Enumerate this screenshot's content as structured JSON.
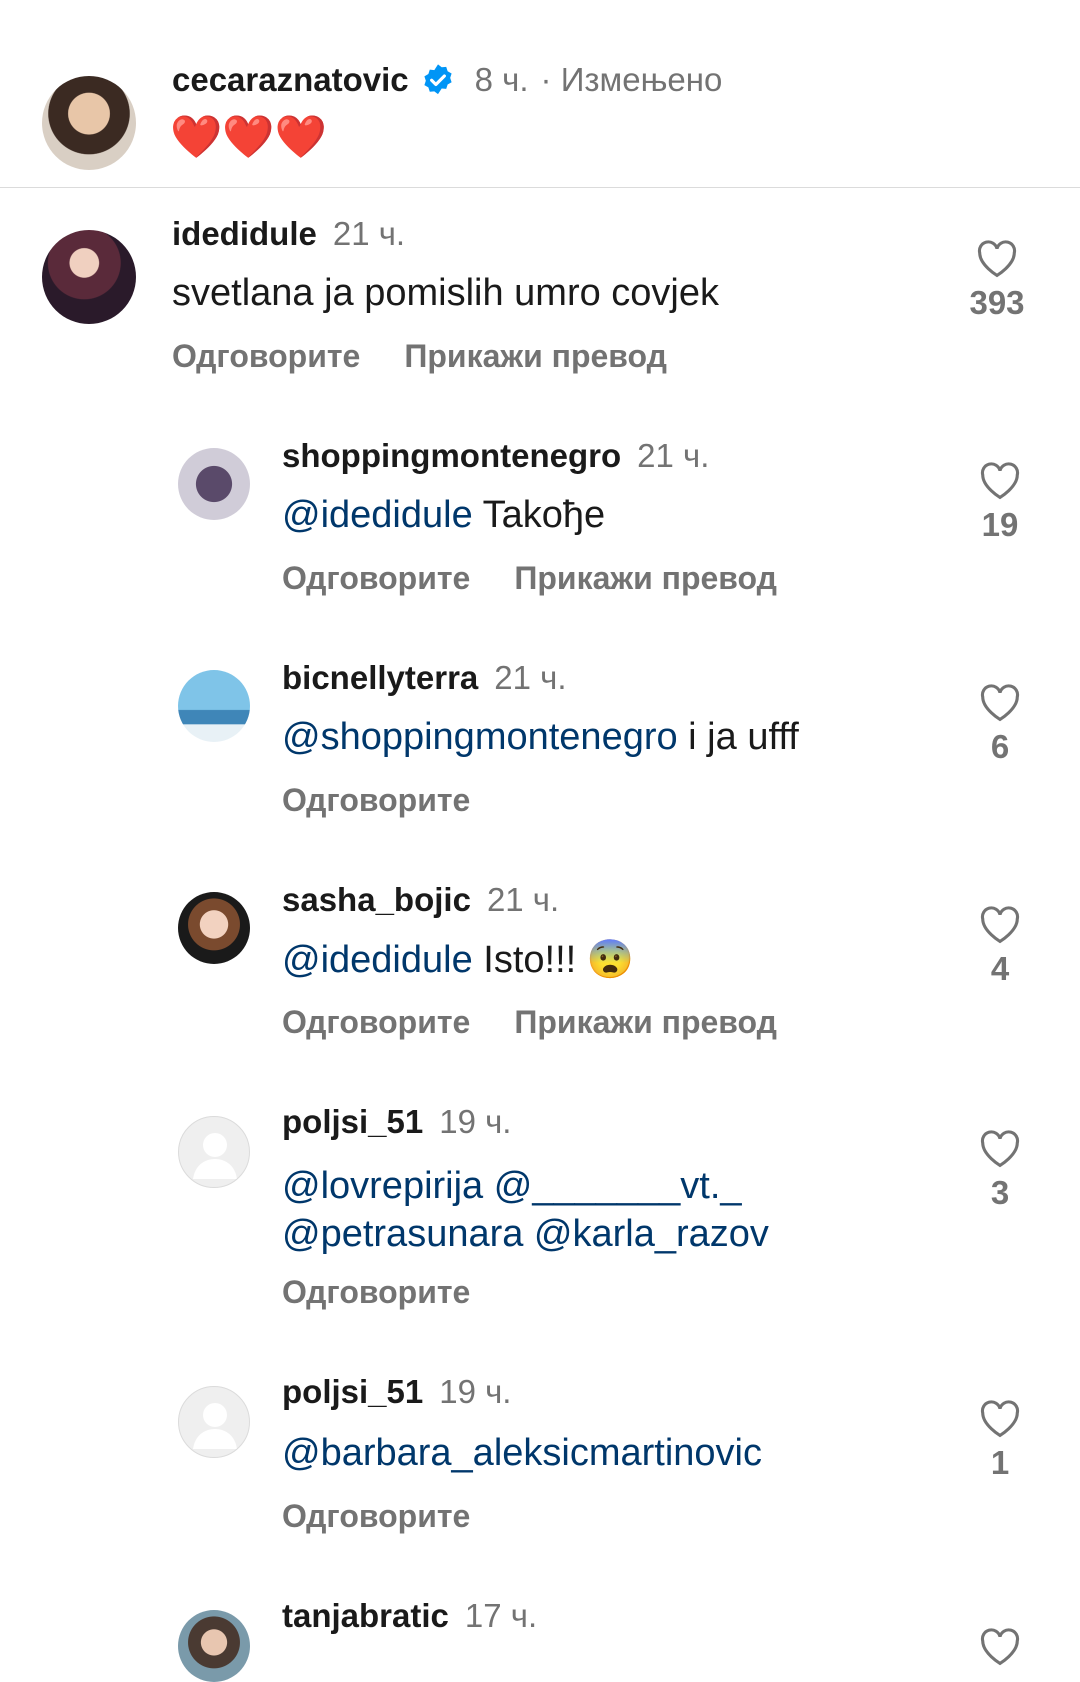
{
  "post": {
    "author": "cecaraznatovic",
    "time": "8 ч.",
    "edited": "· Измењено",
    "caption": "❤️❤️❤️",
    "verified_icon": "verified-badge-icon"
  },
  "actions": {
    "reply": "Одговорите",
    "translate": "Прикажи превод"
  },
  "comments": [
    {
      "user": "idedidule",
      "time": "21 ч.",
      "mention": "",
      "text": "svetlana ja pomislih umro covjek",
      "likes": "393"
    },
    {
      "user": "shoppingmontenegro",
      "time": "21 ч.",
      "mention": "@idedidule",
      "text": " Takође",
      "likes": "19"
    },
    {
      "user": "bicnellyterra",
      "time": "21 ч.",
      "mention": "@shoppingmontenegro",
      "text": " i ja ufff",
      "likes": "6"
    },
    {
      "user": "sasha_bojic",
      "time": "21 ч.",
      "mention": "@idedidule",
      "text": " Isto!!! 😨",
      "likes": "4"
    },
    {
      "user": "poljsi_51",
      "time": "19 ч.",
      "mention_line1": "@lovrepirija @_______vt._",
      "mention_line2": "@petrasunara  @karla_razov",
      "likes": "3"
    },
    {
      "user": "poljsi_51",
      "time": "19 ч.",
      "mention": "@barbara_aleksicmartinovic",
      "text": "",
      "likes": "1"
    },
    {
      "user": "tanjabratic",
      "time": "17 ч."
    }
  ]
}
